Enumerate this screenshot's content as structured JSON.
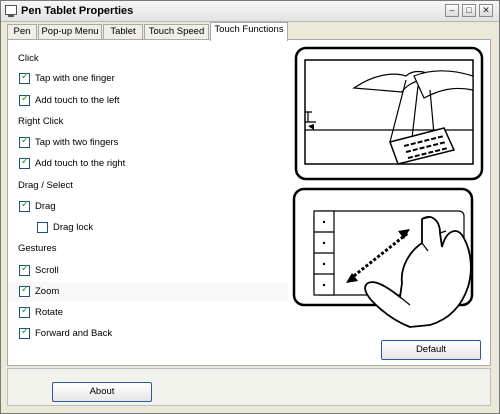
{
  "window": {
    "title": "Pen Tablet Properties",
    "controls": {
      "minimize": "–",
      "maximize": "□",
      "close": "✕"
    }
  },
  "tabs": [
    {
      "label": "Pen"
    },
    {
      "label": "Pop-up Menu"
    },
    {
      "label": "Tablet"
    },
    {
      "label": "Touch Speed"
    },
    {
      "label": "Touch Functions",
      "active": true
    }
  ],
  "sections": {
    "click": "Click",
    "right_click": "Right Click",
    "drag_select": "Drag / Select",
    "gestures": "Gestures"
  },
  "options": {
    "tap_one_finger": {
      "label": "Tap with one finger",
      "checked": true
    },
    "add_touch_left": {
      "label": "Add touch to the left",
      "checked": true
    },
    "tap_two_fingers": {
      "label": "Tap with two fingers",
      "checked": true
    },
    "add_touch_right": {
      "label": "Add touch to the right",
      "checked": true
    },
    "drag": {
      "label": "Drag",
      "checked": true
    },
    "drag_lock": {
      "label": "Drag lock",
      "checked": false
    },
    "scroll": {
      "label": "Scroll",
      "checked": true
    },
    "zoom": {
      "label": "Zoom",
      "checked": true
    },
    "rotate": {
      "label": "Rotate",
      "checked": true
    },
    "forward_back": {
      "label": "Forward and Back",
      "checked": true
    }
  },
  "buttons": {
    "default": "Default",
    "about": "About"
  }
}
